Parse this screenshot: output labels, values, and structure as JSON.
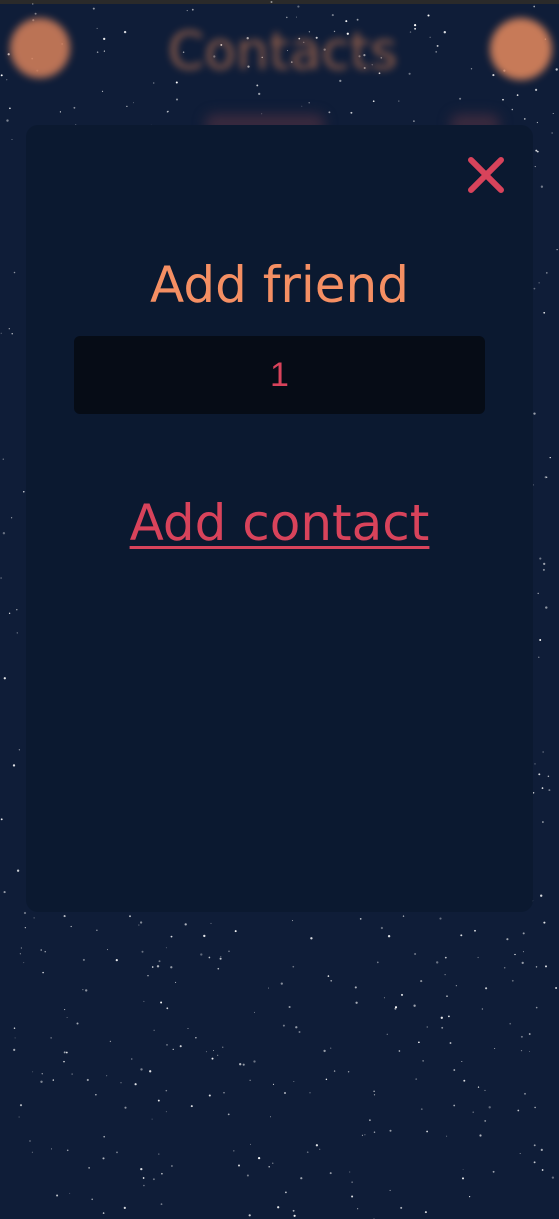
{
  "background": {
    "header_title": "Contacts",
    "color": "#0f1d38"
  },
  "modal": {
    "title": "Add friend",
    "input_value": "1",
    "action_label": "Add contact",
    "close_icon": "close-icon"
  },
  "colors": {
    "accent_orange": "#f58f63",
    "accent_red": "#d8435b",
    "modal_bg": "#0b1930",
    "input_bg": "#060c16"
  }
}
